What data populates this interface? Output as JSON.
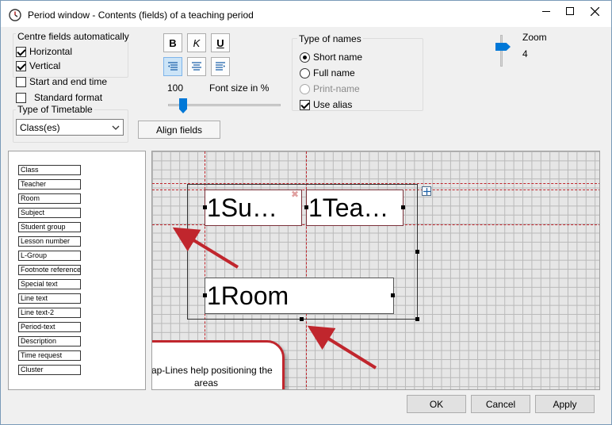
{
  "window": {
    "title": "Period window - Contents (fields) of a teaching period",
    "controls": [
      "minimize-icon",
      "maximize-icon",
      "close-icon"
    ]
  },
  "centre_fields": {
    "label": "Centre fields automatically",
    "horizontal": {
      "label": "Horizontal",
      "checked": true
    },
    "vertical": {
      "label": "Vertical",
      "checked": true
    }
  },
  "options": {
    "start_end_time": {
      "label": "Start and end time",
      "checked": false
    },
    "standard_format": {
      "label": "Standard format",
      "checked": false
    }
  },
  "timetable_type": {
    "label": "Type of Timetable",
    "value": "Class(es)"
  },
  "format": {
    "bold": "B",
    "italic": "K",
    "underline": "U",
    "font_size_value": "100",
    "font_size_label": "Font size in %",
    "font_size_slider": 0.1
  },
  "align_button": "Align fields",
  "type_of_names": {
    "label": "Type of names",
    "short": {
      "label": "Short name",
      "selected": true
    },
    "full": {
      "label": "Full name",
      "selected": false
    },
    "print": {
      "label": "Print-name",
      "selected": false,
      "disabled": true
    },
    "alias": {
      "label": "Use alias",
      "checked": true
    }
  },
  "zoom": {
    "label": "Zoom",
    "value": "4"
  },
  "fields": [
    "Class",
    "Teacher",
    "Room",
    "Subject",
    "Student group",
    "Lesson number",
    "L-Group",
    "Footnote reference",
    "Special text",
    "Line text",
    "Line text-2",
    "Period-text",
    "Description",
    "Time request",
    "Cluster"
  ],
  "areas": {
    "subject": "1Su…",
    "teacher": "1Tea…",
    "room": "1Room"
  },
  "callout": "Snap-Lines help positioning the areas",
  "buttons": {
    "ok": "OK",
    "cancel": "Cancel",
    "apply": "Apply"
  },
  "colors": {
    "accent": "#c0262d",
    "slider": "#0078d7",
    "grid": "#b9b9b9"
  }
}
